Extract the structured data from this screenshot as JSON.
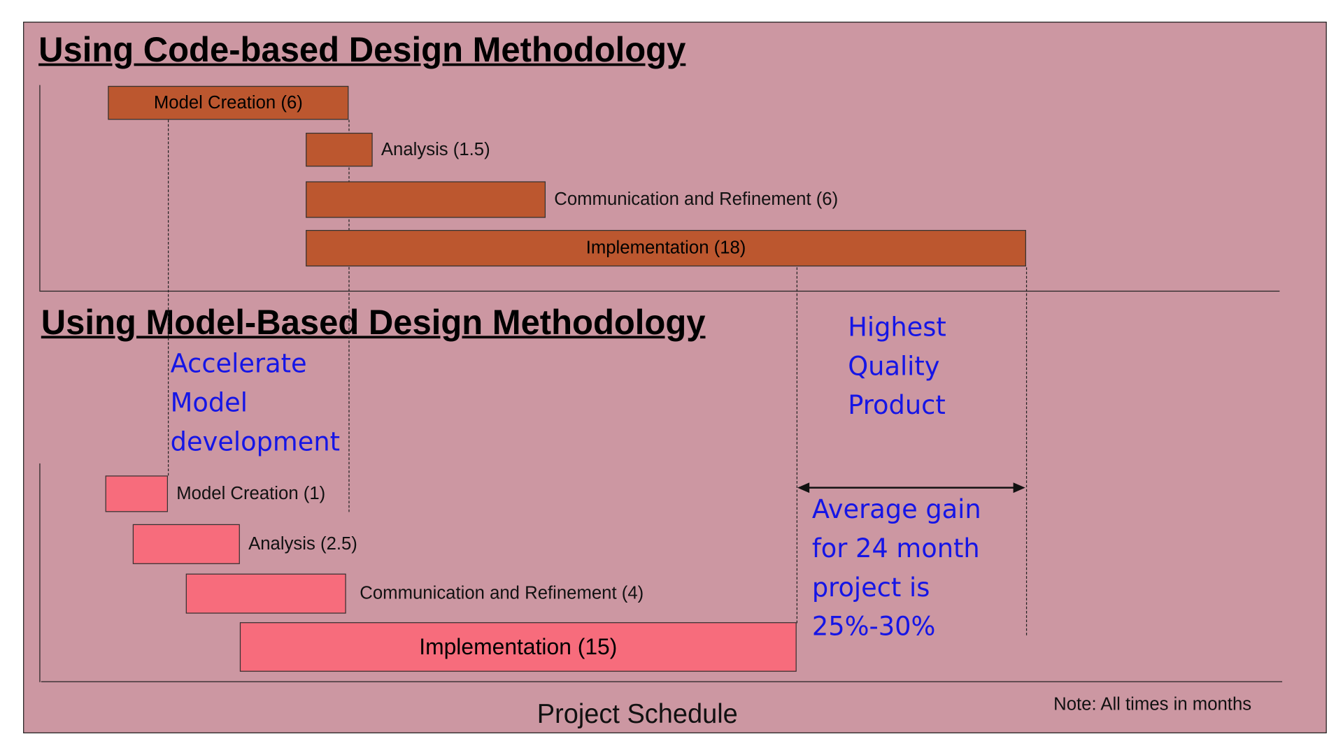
{
  "chart_data": {
    "type": "gantt",
    "title_top": "Using Code-based Design Methodology",
    "title_bottom": "Using Model-Based Design Methodology",
    "xlabel": "Project Schedule",
    "note": "Note: All times in months",
    "code_based_tasks": [
      {
        "label": "Model Creation (6)",
        "name": "Model Creation",
        "duration": 6
      },
      {
        "label": "Analysis (1.5)",
        "name": "Analysis",
        "duration": 1.5
      },
      {
        "label": "Communication and Refinement (6)",
        "name": "Communication and Refinement",
        "duration": 6
      },
      {
        "label": "Implementation (18)",
        "name": "Implementation",
        "duration": 18
      }
    ],
    "model_based_tasks": [
      {
        "label": "Model Creation (1)",
        "name": "Model Creation",
        "duration": 1
      },
      {
        "label": "Analysis (2.5)",
        "name": "Analysis",
        "duration": 2.5
      },
      {
        "label": "Communication and Refinement (4)",
        "name": "Communication and Refinement",
        "duration": 4
      },
      {
        "label": "Implementation (15)",
        "name": "Implementation",
        "duration": 15
      }
    ],
    "annotations": {
      "accelerate": [
        "Accelerate",
        "Model",
        "development"
      ],
      "quality": [
        "Highest",
        "Quality",
        "Product"
      ],
      "gain": [
        "Average gain",
        "for 24 month",
        "project is",
        "25%-30%"
      ]
    },
    "colors": {
      "background": "#CC97A2",
      "code_based_bar": "#BC572F",
      "model_based_bar": "#F76C7C",
      "annotation": "#1515E6"
    }
  }
}
